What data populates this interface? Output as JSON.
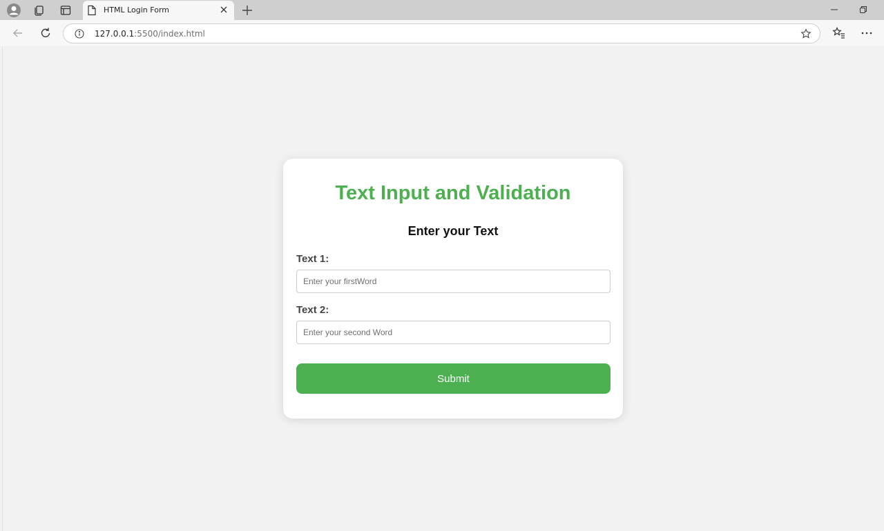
{
  "browser": {
    "tab_title": "HTML Login Form",
    "url_host": "127.0.0.1",
    "url_rest": ":5500/index.html"
  },
  "page": {
    "heading": "Text Input and Validation",
    "subheading": "Enter your Text",
    "field1": {
      "label": "Text 1:",
      "placeholder": "Enter your firstWord",
      "value": ""
    },
    "field2": {
      "label": "Text 2:",
      "placeholder": "Enter your second Word",
      "value": ""
    },
    "submit_label": "Submit"
  },
  "colors": {
    "accent": "#4caf50",
    "background": "#f2f2f2",
    "card": "#ffffff"
  }
}
